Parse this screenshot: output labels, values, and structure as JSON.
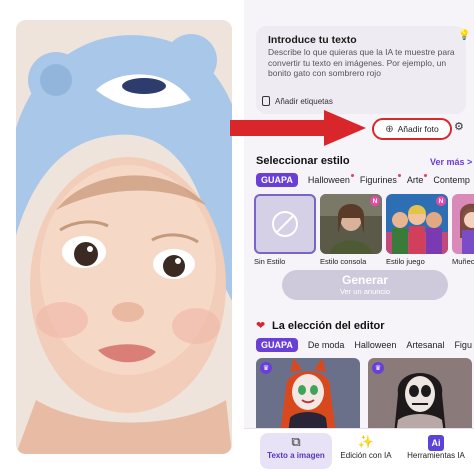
{
  "prompt": {
    "title": "Introduce tu texto",
    "description": "Describe lo que quieras que la IA te muestre para convertir tu texto en imágenes. Por ejemplo, un bonito gato con sombrero rojo",
    "tags_label": "Añadir etiquetas"
  },
  "add_photo_label": "Añadir foto",
  "style_section": {
    "title": "Seleccionar estilo",
    "see_more": "Ver más >",
    "chips": [
      "GUAPA",
      "Halloween",
      "Figurines",
      "Arte",
      "Contemp"
    ],
    "styles": [
      {
        "label": "Sin Estilo"
      },
      {
        "label": "Estilo consola"
      },
      {
        "label": "Estilo juego"
      },
      {
        "label": "Muñeca"
      }
    ]
  },
  "generate": {
    "label": "Generar",
    "sublabel": "Ver un anuncio"
  },
  "editor_section": {
    "title": "La elección del editor",
    "chips": [
      "GUAPA",
      "De moda",
      "Halloween",
      "Artesanal",
      "Figu"
    ]
  },
  "bottom_nav": [
    {
      "label": "Texto a imagen",
      "icon": "text-to-image-icon",
      "active": true
    },
    {
      "label": "Edición con IA",
      "icon": "magic-wand-icon",
      "active": false
    },
    {
      "label": "Herramientas IA",
      "icon": "ai-tools-icon",
      "active": false
    }
  ],
  "ai_badge": "Ai",
  "badge_new": "N",
  "colors": {
    "accent": "#6a3fd6",
    "highlight": "#d9262b",
    "generate_disabled": "#cfcadb"
  }
}
